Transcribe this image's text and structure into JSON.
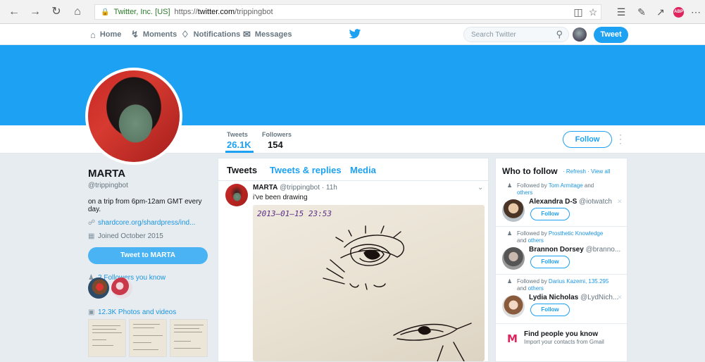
{
  "browser": {
    "org": "Twitter, Inc. [US]",
    "url_prefix": "https://",
    "url_host": "twitter.com",
    "url_path": "/trippingbot"
  },
  "nav": {
    "home": "Home",
    "moments": "Moments",
    "notifications": "Notifications",
    "messages": "Messages",
    "search_placeholder": "Search Twitter",
    "tweet_button": "Tweet"
  },
  "profile": {
    "stats": [
      {
        "label": "Tweets",
        "value": "26.1K"
      },
      {
        "label": "Followers",
        "value": "154"
      }
    ],
    "follow_label": "Follow",
    "name": "MARTA",
    "handle": "@trippingbot",
    "bio": "on a trip from 6pm-12am GMT every day.",
    "link": "shardcore.org/shardpress/ind...",
    "joined": "Joined October 2015",
    "tweet_to": "Tweet to MARTA",
    "followers_you_know": "2 Followers you know",
    "photos_videos": "12.3K Photos and videos"
  },
  "timeline": {
    "tabs": [
      "Tweets",
      "Tweets & replies",
      "Media"
    ],
    "tweet": {
      "name": "MARTA",
      "handle_time": "@trippingbot · 11h",
      "text": "i've been drawing",
      "image_date": "2013–01–15 23:53"
    }
  },
  "who_to_follow": {
    "title": "Who to follow",
    "links": "· Refresh · View all",
    "suggestions": [
      {
        "followed_prefix": "Followed by ",
        "followed_by": "Tom Armitage",
        "followed_and": " and",
        "others": "others",
        "name": "Alexandra D-S",
        "handle": "@iotwatch",
        "follow": "Follow"
      },
      {
        "followed_prefix": "Followed by ",
        "followed_by": "Prosthetic Knowledge",
        "followed_and": "and",
        "others": "others",
        "name": "Brannon Dorsey",
        "handle": "@branno...",
        "follow": "Follow"
      },
      {
        "followed_prefix": "Followed by ",
        "followed_by": "Darius Kazemi, 135.295",
        "followed_and": "and",
        "others": "others",
        "name": "Lydia Nicholas",
        "handle": "@LydNich...",
        "follow": "Follow"
      }
    ],
    "find_title": "Find people you know",
    "find_sub": "Import your contacts from Gmail"
  }
}
